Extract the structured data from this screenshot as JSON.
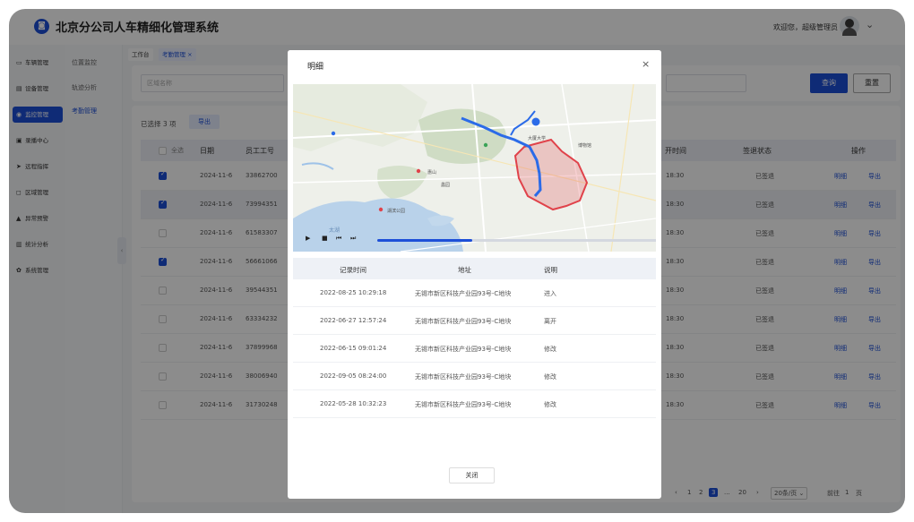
{
  "app": {
    "title": "北京分公司人车精细化管理系统",
    "welcome": "欢迎您，超级管理员"
  },
  "nav_primary": [
    {
      "icon": "car-icon",
      "glyph": "▭",
      "label": "车辆管理"
    },
    {
      "icon": "equipment-icon",
      "glyph": "▤",
      "label": "设备管理"
    },
    {
      "icon": "monitor-icon",
      "glyph": "◉",
      "label": "监控管理",
      "active": true
    },
    {
      "icon": "video-icon",
      "glyph": "▣",
      "label": "录播中心"
    },
    {
      "icon": "remote-icon",
      "glyph": "➤",
      "label": "远程指挥"
    },
    {
      "icon": "area-icon",
      "glyph": "◻",
      "label": "区域管理"
    },
    {
      "icon": "alert-icon",
      "glyph": "▲",
      "label": "异常预警"
    },
    {
      "icon": "stats-icon",
      "glyph": "▥",
      "label": "统计分析"
    },
    {
      "icon": "system-icon",
      "glyph": "✿",
      "label": "系统管理"
    }
  ],
  "nav_secondary": [
    {
      "label": "位置监控"
    },
    {
      "label": "轨迹分析"
    },
    {
      "label": "考勤管理",
      "active": true
    }
  ],
  "tabs": [
    {
      "label": "工作台"
    },
    {
      "label": "考勤管理 ×",
      "active": true
    }
  ],
  "filter": {
    "placeholder": "区域名称",
    "query_label": "查询",
    "reset_label": "重置"
  },
  "table": {
    "selected_text": "已选择 3 项",
    "export_label": "导出",
    "headers": {
      "select_all": "全选",
      "date": "日期",
      "emp_id": "员工工号",
      "leave_time": "开时间",
      "sign_status": "签退状态",
      "ops": "操作"
    },
    "rows": [
      {
        "checked": true,
        "date": "2024-11-6",
        "emp_id": "33862700",
        "time": "18:30",
        "status": "已签退",
        "detail": "明细",
        "export": "导出"
      },
      {
        "checked": true,
        "date": "2024-11-6",
        "emp_id": "73994351",
        "time": "18:30",
        "status": "已签退",
        "detail": "明细",
        "export": "导出"
      },
      {
        "checked": false,
        "date": "2024-11-6",
        "emp_id": "61583307",
        "time": "18:30",
        "status": "已签退",
        "detail": "明细",
        "export": "导出"
      },
      {
        "checked": true,
        "date": "2024-11-6",
        "emp_id": "56661066",
        "time": "18:30",
        "status": "已签退",
        "detail": "明细",
        "export": "导出"
      },
      {
        "checked": false,
        "date": "2024-11-6",
        "emp_id": "39544351",
        "time": "18:30",
        "status": "已签退",
        "detail": "明细",
        "export": "导出"
      },
      {
        "checked": false,
        "date": "2024-11-6",
        "emp_id": "63334232",
        "time": "18:30",
        "status": "已签退",
        "detail": "明细",
        "export": "导出"
      },
      {
        "checked": false,
        "date": "2024-11-6",
        "emp_id": "37899968",
        "time": "18:30",
        "status": "已签退",
        "detail": "明细",
        "export": "导出"
      },
      {
        "checked": false,
        "date": "2024-11-6",
        "emp_id": "38006940",
        "time": "18:30",
        "status": "已签退",
        "detail": "明细",
        "export": "导出"
      },
      {
        "checked": false,
        "date": "2024-11-6",
        "emp_id": "31730248",
        "time": "18:30",
        "status": "已签退",
        "detail": "明细",
        "export": "导出"
      }
    ]
  },
  "pagination": {
    "prev": "‹",
    "p1": "1",
    "p2": "2",
    "p3": "3",
    "ellipsis": "...",
    "last": "20",
    "next": "›",
    "page_size": "20条/页 ⌄",
    "goto_label": "前往",
    "goto_value": "1",
    "goto_suffix": "页"
  },
  "modal": {
    "title": "明细",
    "close_icon": "×",
    "map_labels": {
      "a": "大厦大学",
      "b": "博物馆",
      "c": "惠山",
      "d": "湖滨公园",
      "e": "蠡园",
      "f": "太湖"
    },
    "player": {
      "play": "▶",
      "stop": "■",
      "prev": "⏮",
      "next": "⏭",
      "progress": 0.33
    },
    "headers": {
      "time": "记录时间",
      "address": "地址",
      "note": "说明"
    },
    "records": [
      {
        "time": "2022-08-25 10:29:18",
        "address": "无锡市新区科技产业园93号-C地块",
        "note": "进入"
      },
      {
        "time": "2022-06-27 12:57:24",
        "address": "无锡市新区科技产业园93号-C地块",
        "note": "离开"
      },
      {
        "time": "2022-06-15 09:01:24",
        "address": "无锡市新区科技产业园93号-C地块",
        "note": "修改"
      },
      {
        "time": "2022-09-05 08:24:00",
        "address": "无锡市新区科技产业园93号-C地块",
        "note": "修改"
      },
      {
        "time": "2022-05-28 10:32:23",
        "address": "无锡市新区科技产业园93号-C地块",
        "note": "修改"
      }
    ],
    "close_label": "关闭"
  },
  "colors": {
    "primary": "#1d4fd8",
    "route": "#2b6be8",
    "geofence": "#e0424a"
  }
}
